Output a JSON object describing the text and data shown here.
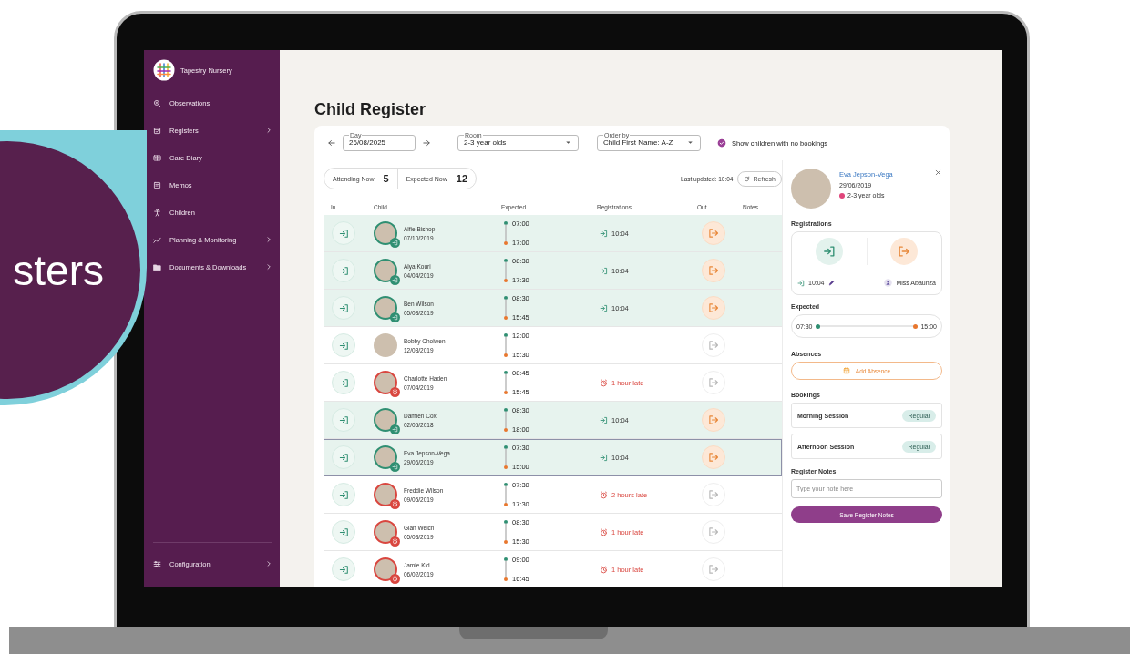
{
  "promo_badge": {
    "text": "sters"
  },
  "sidebar": {
    "brand": "Tapestry Nursery",
    "items": [
      {
        "label": "Observations",
        "kind": "search",
        "has_submenu": false
      },
      {
        "label": "Registers",
        "kind": "calendar",
        "has_submenu": true
      },
      {
        "label": "Care Diary",
        "kind": "diary",
        "has_submenu": false
      },
      {
        "label": "Memos",
        "kind": "memo",
        "has_submenu": false
      },
      {
        "label": "Children",
        "kind": "person",
        "has_submenu": false
      },
      {
        "label": "Planning & Monitoring",
        "kind": "chart",
        "has_submenu": true
      },
      {
        "label": "Documents & Downloads",
        "kind": "folder",
        "has_submenu": true
      }
    ],
    "footer_item": {
      "label": "Configuration",
      "kind": "sliders",
      "has_submenu": true
    }
  },
  "page_title": "Child Register",
  "filters": {
    "day": {
      "label": "Day",
      "value": "26/08/2025"
    },
    "room": {
      "label": "Room",
      "value": "2-3 year olds"
    },
    "order_by": {
      "label": "Order by",
      "value": "Child First Name: A-Z"
    },
    "show_no_bookings": {
      "label": "Show children with no bookings",
      "checked": true
    }
  },
  "stats": [
    {
      "label": "Attending Now",
      "value": "5"
    },
    {
      "label": "Expected Now",
      "value": "12"
    }
  ],
  "last_updated": "Last updated: 10:04",
  "refresh_button": "Refresh",
  "table": {
    "columns": [
      "In",
      "Child",
      "Expected",
      "Registrations",
      "Out",
      "Notes"
    ],
    "rows": [
      {
        "name": "Alfie Bishop",
        "dob": "07/10/2019",
        "expected_in": "07:00",
        "expected_out": "17:00",
        "kind": "in",
        "registration": "10:04",
        "selected": false
      },
      {
        "name": "Alya Kouri",
        "dob": "04/04/2019",
        "expected_in": "08:30",
        "expected_out": "17:30",
        "kind": "in",
        "registration": "10:04",
        "selected": false
      },
      {
        "name": "Ben Wilson",
        "dob": "05/08/2019",
        "expected_in": "08:30",
        "expected_out": "15:45",
        "kind": "in",
        "registration": "10:04",
        "selected": false
      },
      {
        "name": "Bobby Cholwen",
        "dob": "12/08/2019",
        "expected_in": "12:00",
        "expected_out": "15:30",
        "kind": "expected",
        "selected": false
      },
      {
        "name": "Charlotte Haden",
        "dob": "07/04/2019",
        "expected_in": "08:45",
        "expected_out": "15:45",
        "kind": "late",
        "registration": "1 hour late",
        "selected": false
      },
      {
        "name": "Damien Cox",
        "dob": "02/05/2018",
        "expected_in": "08:30",
        "expected_out": "18:00",
        "kind": "in",
        "registration": "10:04",
        "selected": false
      },
      {
        "name": "Eva Jepson-Vega",
        "dob": "29/06/2019",
        "expected_in": "07:30",
        "expected_out": "15:00",
        "kind": "in",
        "registration": "10:04",
        "selected": true
      },
      {
        "name": "Freddie Wilson",
        "dob": "09/05/2019",
        "expected_in": "07:30",
        "expected_out": "17:30",
        "kind": "late",
        "registration": "2 hours late",
        "selected": false
      },
      {
        "name": "Glah Welch",
        "dob": "05/03/2019",
        "expected_in": "08:30",
        "expected_out": "15:30",
        "kind": "late",
        "registration": "1 hour late",
        "selected": false
      },
      {
        "name": "Jamie Kid",
        "dob": "06/02/2019",
        "expected_in": "09:00",
        "expected_out": "16:45",
        "kind": "late",
        "registration": "1 hour late",
        "selected": false
      }
    ]
  },
  "detail": {
    "name": "Eva Jepson-Vega",
    "dob": "29/06/2019",
    "room": "2-3 year olds",
    "registrations": {
      "heading": "Registrations",
      "time": "10:04",
      "staff": "Miss Abaunza"
    },
    "expected": {
      "heading": "Expected",
      "start": "07:30",
      "end": "15:00"
    },
    "absences": {
      "heading": "Absences",
      "button": "Add Absence"
    },
    "bookings": {
      "heading": "Bookings",
      "items": [
        {
          "name": "Morning Session",
          "tag": "Regular"
        },
        {
          "name": "Afternoon Session",
          "tag": "Regular"
        }
      ]
    },
    "notes": {
      "heading": "Register Notes",
      "placeholder": "Type your note here",
      "button": "Save Register Notes"
    }
  }
}
